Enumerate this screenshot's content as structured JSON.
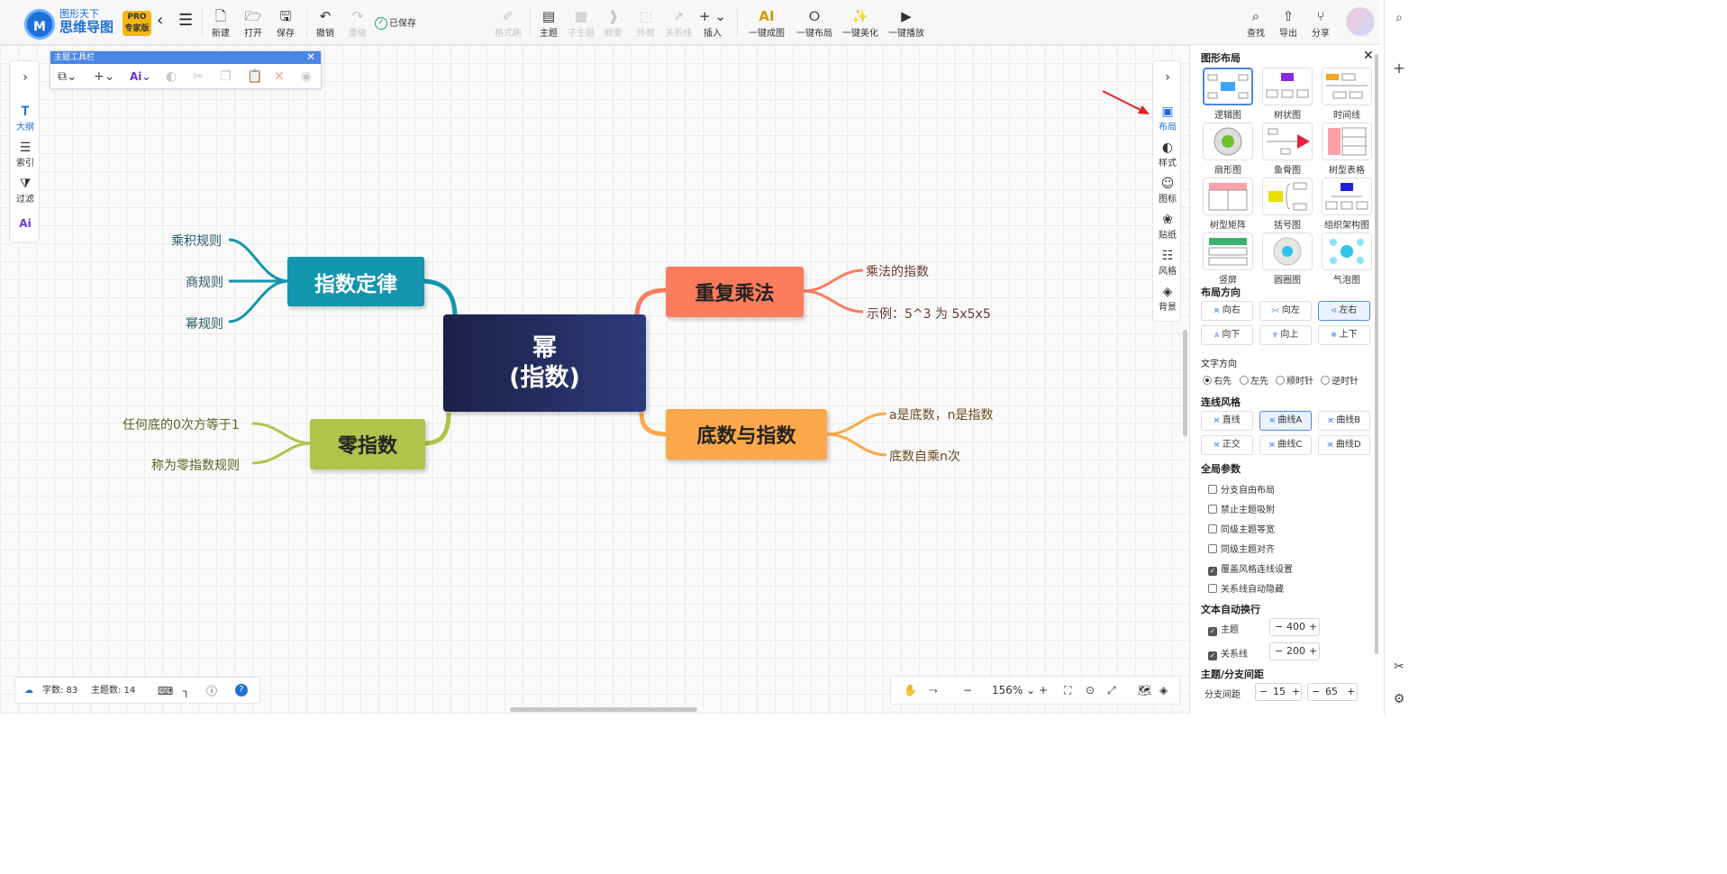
{
  "app": {
    "logo_line1": "图形天下",
    "logo_line2": "思维导图",
    "pro_label": "PRO",
    "edition_label": "专家版",
    "saved_status": "已保存"
  },
  "toolbar": {
    "new": "新建",
    "open": "打开",
    "save": "保存",
    "undo": "撤销",
    "redo": "重做",
    "format_brush": "格式刷",
    "topic": "主题",
    "subtopic": "子主题",
    "summary": "概要",
    "boundary": "外框",
    "relation": "关系线",
    "insert": "插入",
    "one_key_map": "一键成图",
    "one_key_layout": "一键布局",
    "one_key_beautify": "一键美化",
    "one_key_play": "一键播放",
    "search": "查找",
    "export": "导出",
    "share": "分享"
  },
  "topic_toolbar": {
    "title": "主题工具栏"
  },
  "left_panel": {
    "outline": "大纲",
    "index": "索引",
    "filter": "过滤"
  },
  "right_icons": {
    "layout": "布局",
    "style": "样式",
    "icon": "图标",
    "sticker": "贴纸",
    "theme_style": "风格",
    "background": "背景"
  },
  "mindmap": {
    "center_line1": "幂",
    "center_line2": "(指数)",
    "topics": {
      "laws": {
        "label": "指数定律",
        "color": "#1295ad"
      },
      "repeat": {
        "label": "重复乘法",
        "color": "#fa7c5d"
      },
      "zero": {
        "label": "零指数",
        "color": "#b2c34b"
      },
      "base": {
        "label": "底数与指数",
        "color": "#fda84a"
      }
    },
    "leaves": {
      "product": "乘积规则",
      "quotient": "商规则",
      "power": "幂规则",
      "mult_exp": "乘法的指数",
      "example": "示例：5^3 为 5x5x5",
      "zero1": "任何底的0次方等于1",
      "zero2": "称为零指数规则",
      "base1": "a是底数，n是指数",
      "base2": "底数自乘n次"
    },
    "center_color": "#262d5f"
  },
  "status": {
    "word_count": "字数: 83",
    "topic_count": "主题数: 14",
    "zoom": "156%"
  },
  "side_panel": {
    "title": "图形布局",
    "layouts": [
      "逻辑图",
      "树状图",
      "时间线",
      "扇形图",
      "鱼骨图",
      "树型表格",
      "树型矩阵",
      "括号图",
      "组织架构图",
      "竖屏",
      "圆圈图",
      "气泡图"
    ],
    "direction_title": "布局方向",
    "directions": [
      "向右",
      "向左",
      "左右",
      "向下",
      "向上",
      "上下"
    ],
    "text_dir_title": "文字方向",
    "text_dirs": [
      "右先",
      "左先",
      "顺时针",
      "逆时针"
    ],
    "line_style_title": "连线风格",
    "line_styles": [
      "直线",
      "曲线A",
      "曲线B",
      "正交",
      "曲线C",
      "曲线D"
    ],
    "global_title": "全局参数",
    "globals": [
      "分支自由布局",
      "禁止主题吸附",
      "同级主题等宽",
      "同级主题对齐",
      "覆盖风格连线设置",
      "关系线自动隐藏"
    ],
    "wrap_title": "文本自动换行",
    "wrap_topic": "主题",
    "wrap_topic_value": "400",
    "wrap_relation": "关系线",
    "wrap_relation_value": "200",
    "spacing_title": "主题/分支间距",
    "branch_spacing": "分支间距",
    "branch_value1": "15",
    "branch_value2": "65"
  }
}
